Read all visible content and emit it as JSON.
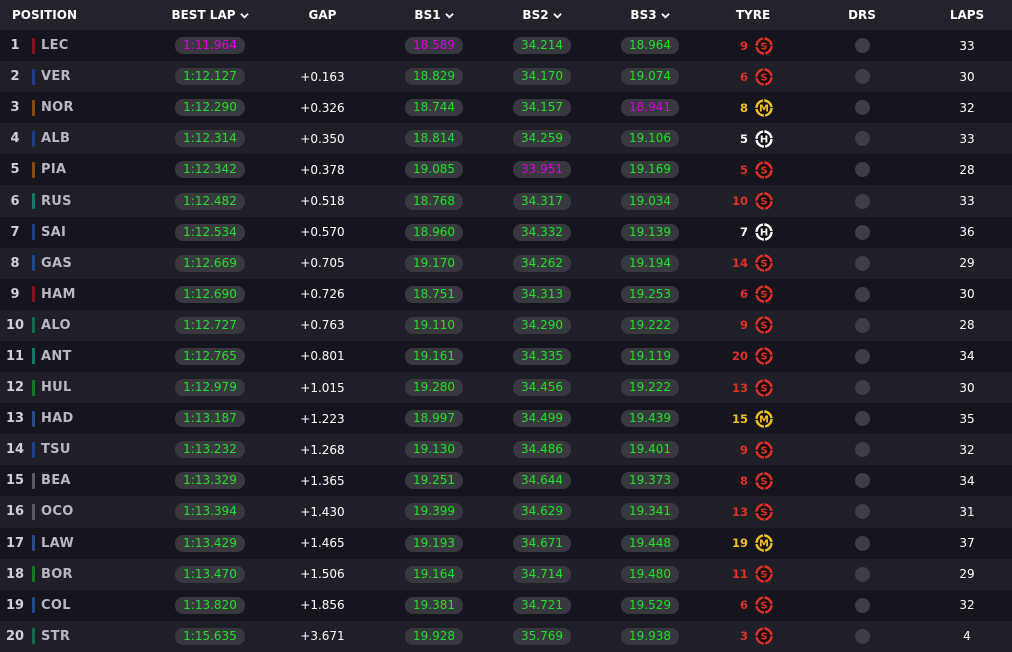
{
  "colors": {
    "fastest": "#e000e0",
    "personal": "#22e02a",
    "soft": "#e0302a",
    "medium": "#f0c020",
    "hard": "#ffffff",
    "team": {
      "ferrari": "#8a0f1f",
      "redbull": "#223d8a",
      "mclaren": "#8a4a12",
      "williams": "#1e3f86",
      "mercedes": "#0f7a66",
      "alpine": "#1f4a8a",
      "astonmartin": "#146a4a",
      "sauber": "#137a28",
      "rb": "#2b4a8a",
      "haas": "#5a5a62"
    }
  },
  "icons": {
    "sort": "chevron-down-icon",
    "tyre": "tyre-compound-icon",
    "drs": "drs-indicator-icon"
  },
  "header": {
    "position": "POSITION",
    "best_lap": "BEST LAP",
    "gap": "GAP",
    "bs1": "BS1",
    "bs2": "BS2",
    "bs3": "BS3",
    "tyre": "TYRE",
    "drs": "DRS",
    "laps": "LAPS"
  },
  "rows": [
    {
      "pos": "1",
      "driver": "LEC",
      "team": "ferrari",
      "best": "1:11.964",
      "best_c": "fastest",
      "gap": "",
      "bs1": "18.589",
      "bs1_c": "fastest",
      "bs2": "34.214",
      "bs2_c": "personal",
      "bs3": "18.964",
      "bs3_c": "personal",
      "tyre_laps": "9",
      "tyre": "S",
      "laps": "33"
    },
    {
      "pos": "2",
      "driver": "VER",
      "team": "redbull",
      "best": "1:12.127",
      "best_c": "personal",
      "gap": "+0.163",
      "bs1": "18.829",
      "bs1_c": "personal",
      "bs2": "34.170",
      "bs2_c": "personal",
      "bs3": "19.074",
      "bs3_c": "personal",
      "tyre_laps": "6",
      "tyre": "S",
      "laps": "30"
    },
    {
      "pos": "3",
      "driver": "NOR",
      "team": "mclaren",
      "best": "1:12.290",
      "best_c": "personal",
      "gap": "+0.326",
      "bs1": "18.744",
      "bs1_c": "personal",
      "bs2": "34.157",
      "bs2_c": "personal",
      "bs3": "18.941",
      "bs3_c": "fastest",
      "tyre_laps": "8",
      "tyre": "M",
      "laps": "32"
    },
    {
      "pos": "4",
      "driver": "ALB",
      "team": "williams",
      "best": "1:12.314",
      "best_c": "personal",
      "gap": "+0.350",
      "bs1": "18.814",
      "bs1_c": "personal",
      "bs2": "34.259",
      "bs2_c": "personal",
      "bs3": "19.106",
      "bs3_c": "personal",
      "tyre_laps": "5",
      "tyre": "H",
      "laps": "33"
    },
    {
      "pos": "5",
      "driver": "PIA",
      "team": "mclaren",
      "best": "1:12.342",
      "best_c": "personal",
      "gap": "+0.378",
      "bs1": "19.085",
      "bs1_c": "personal",
      "bs2": "33.951",
      "bs2_c": "fastest",
      "bs3": "19.169",
      "bs3_c": "personal",
      "tyre_laps": "5",
      "tyre": "S",
      "laps": "28"
    },
    {
      "pos": "6",
      "driver": "RUS",
      "team": "mercedes",
      "best": "1:12.482",
      "best_c": "personal",
      "gap": "+0.518",
      "bs1": "18.768",
      "bs1_c": "personal",
      "bs2": "34.317",
      "bs2_c": "personal",
      "bs3": "19.034",
      "bs3_c": "personal",
      "tyre_laps": "10",
      "tyre": "S",
      "laps": "33"
    },
    {
      "pos": "7",
      "driver": "SAI",
      "team": "williams",
      "best": "1:12.534",
      "best_c": "personal",
      "gap": "+0.570",
      "bs1": "18.960",
      "bs1_c": "personal",
      "bs2": "34.332",
      "bs2_c": "personal",
      "bs3": "19.139",
      "bs3_c": "personal",
      "tyre_laps": "7",
      "tyre": "H",
      "laps": "36"
    },
    {
      "pos": "8",
      "driver": "GAS",
      "team": "alpine",
      "best": "1:12.669",
      "best_c": "personal",
      "gap": "+0.705",
      "bs1": "19.170",
      "bs1_c": "personal",
      "bs2": "34.262",
      "bs2_c": "personal",
      "bs3": "19.194",
      "bs3_c": "personal",
      "tyre_laps": "14",
      "tyre": "S",
      "laps": "29"
    },
    {
      "pos": "9",
      "driver": "HAM",
      "team": "ferrari",
      "best": "1:12.690",
      "best_c": "personal",
      "gap": "+0.726",
      "bs1": "18.751",
      "bs1_c": "personal",
      "bs2": "34.313",
      "bs2_c": "personal",
      "bs3": "19.253",
      "bs3_c": "personal",
      "tyre_laps": "6",
      "tyre": "S",
      "laps": "30"
    },
    {
      "pos": "10",
      "driver": "ALO",
      "team": "astonmartin",
      "best": "1:12.727",
      "best_c": "personal",
      "gap": "+0.763",
      "bs1": "19.110",
      "bs1_c": "personal",
      "bs2": "34.290",
      "bs2_c": "personal",
      "bs3": "19.222",
      "bs3_c": "personal",
      "tyre_laps": "9",
      "tyre": "S",
      "laps": "28"
    },
    {
      "pos": "11",
      "driver": "ANT",
      "team": "mercedes",
      "best": "1:12.765",
      "best_c": "personal",
      "gap": "+0.801",
      "bs1": "19.161",
      "bs1_c": "personal",
      "bs2": "34.335",
      "bs2_c": "personal",
      "bs3": "19.119",
      "bs3_c": "personal",
      "tyre_laps": "20",
      "tyre": "S",
      "laps": "34"
    },
    {
      "pos": "12",
      "driver": "HUL",
      "team": "sauber",
      "best": "1:12.979",
      "best_c": "personal",
      "gap": "+1.015",
      "bs1": "19.280",
      "bs1_c": "personal",
      "bs2": "34.456",
      "bs2_c": "personal",
      "bs3": "19.222",
      "bs3_c": "personal",
      "tyre_laps": "13",
      "tyre": "S",
      "laps": "30"
    },
    {
      "pos": "13",
      "driver": "HAD",
      "team": "rb",
      "best": "1:13.187",
      "best_c": "personal",
      "gap": "+1.223",
      "bs1": "18.997",
      "bs1_c": "personal",
      "bs2": "34.499",
      "bs2_c": "personal",
      "bs3": "19.439",
      "bs3_c": "personal",
      "tyre_laps": "15",
      "tyre": "M",
      "laps": "35"
    },
    {
      "pos": "14",
      "driver": "TSU",
      "team": "redbull",
      "best": "1:13.232",
      "best_c": "personal",
      "gap": "+1.268",
      "bs1": "19.130",
      "bs1_c": "personal",
      "bs2": "34.486",
      "bs2_c": "personal",
      "bs3": "19.401",
      "bs3_c": "personal",
      "tyre_laps": "9",
      "tyre": "S",
      "laps": "32"
    },
    {
      "pos": "15",
      "driver": "BEA",
      "team": "haas",
      "best": "1:13.329",
      "best_c": "personal",
      "gap": "+1.365",
      "bs1": "19.251",
      "bs1_c": "personal",
      "bs2": "34.644",
      "bs2_c": "personal",
      "bs3": "19.373",
      "bs3_c": "personal",
      "tyre_laps": "8",
      "tyre": "S",
      "laps": "34"
    },
    {
      "pos": "16",
      "driver": "OCO",
      "team": "haas",
      "best": "1:13.394",
      "best_c": "personal",
      "gap": "+1.430",
      "bs1": "19.399",
      "bs1_c": "personal",
      "bs2": "34.629",
      "bs2_c": "personal",
      "bs3": "19.341",
      "bs3_c": "personal",
      "tyre_laps": "13",
      "tyre": "S",
      "laps": "31"
    },
    {
      "pos": "17",
      "driver": "LAW",
      "team": "rb",
      "best": "1:13.429",
      "best_c": "personal",
      "gap": "+1.465",
      "bs1": "19.193",
      "bs1_c": "personal",
      "bs2": "34.671",
      "bs2_c": "personal",
      "bs3": "19.448",
      "bs3_c": "personal",
      "tyre_laps": "19",
      "tyre": "M",
      "laps": "37"
    },
    {
      "pos": "18",
      "driver": "BOR",
      "team": "sauber",
      "best": "1:13.470",
      "best_c": "personal",
      "gap": "+1.506",
      "bs1": "19.164",
      "bs1_c": "personal",
      "bs2": "34.714",
      "bs2_c": "personal",
      "bs3": "19.480",
      "bs3_c": "personal",
      "tyre_laps": "11",
      "tyre": "S",
      "laps": "29"
    },
    {
      "pos": "19",
      "driver": "COL",
      "team": "alpine",
      "best": "1:13.820",
      "best_c": "personal",
      "gap": "+1.856",
      "bs1": "19.381",
      "bs1_c": "personal",
      "bs2": "34.721",
      "bs2_c": "personal",
      "bs3": "19.529",
      "bs3_c": "personal",
      "tyre_laps": "6",
      "tyre": "S",
      "laps": "32"
    },
    {
      "pos": "20",
      "driver": "STR",
      "team": "astonmartin",
      "best": "1:15.635",
      "best_c": "personal",
      "gap": "+3.671",
      "bs1": "19.928",
      "bs1_c": "personal",
      "bs2": "35.769",
      "bs2_c": "personal",
      "bs3": "19.938",
      "bs3_c": "personal",
      "tyre_laps": "3",
      "tyre": "S",
      "laps": "4"
    }
  ]
}
